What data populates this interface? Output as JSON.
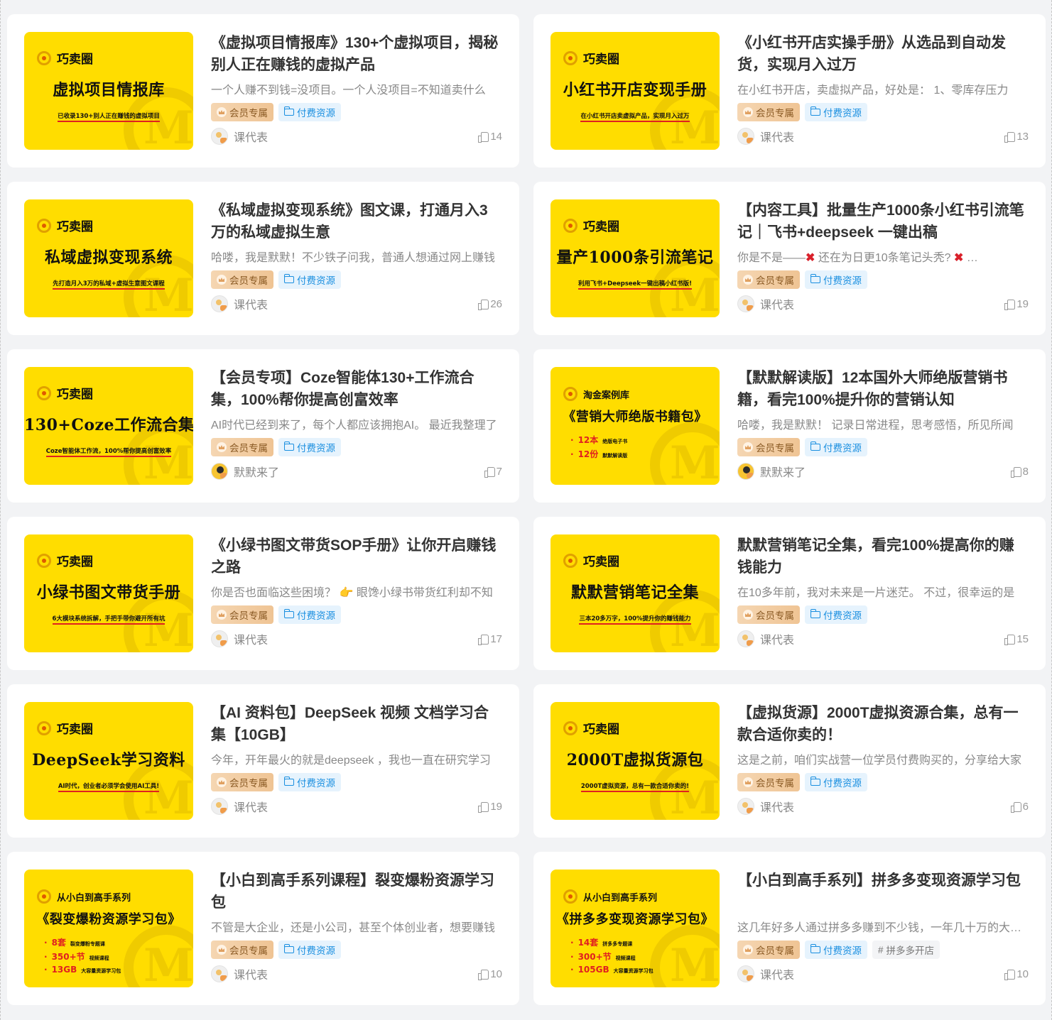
{
  "cards": [
    {
      "thumb": {
        "style": "brand",
        "brand": "巧卖圈",
        "title": "虚拟项目情报库",
        "subtitle": "已收录130+别人正在赚钱的虚拟项目"
      },
      "title": "《虚拟项目情报库》130+个虚拟项目，揭秘别人正在赚钱的虚拟产品",
      "excerpt": "一个人赚不到钱=没项目。一个人没项目=不知道卖什么",
      "tags": [
        "会员专属",
        "付费资源"
      ],
      "author": "课代表",
      "likes": "14"
    },
    {
      "thumb": {
        "style": "brand",
        "brand": "巧卖圈",
        "title": "小红书开店变现手册",
        "subtitle": "在小红书开店卖虚拟产品，实现月入过万"
      },
      "title": "《小红书开店实操手册》从选品到自动发货，实现月入过万",
      "excerpt": "在小红书开店，卖虚拟产品，好处是：  1、零库存压力",
      "tags": [
        "会员专属",
        "付费资源"
      ],
      "author": "课代表",
      "likes": "13"
    },
    {
      "thumb": {
        "style": "brand",
        "brand": "巧卖圈",
        "title": "私域虚拟变现系统",
        "subtitle": "先打造月入3万的私域+虚拟生意图文课程"
      },
      "title": "《私域虚拟变现系统》图文课，打通月入3万的私域虚拟生意",
      "excerpt": "哈喽，我是默默！不少铁子问我，普通人想通过网上赚钱",
      "tags": [
        "会员专属",
        "付费资源"
      ],
      "author": "课代表",
      "likes": "26"
    },
    {
      "thumb": {
        "style": "brand",
        "brand": "巧卖圈",
        "title": "量产1000条引流笔记",
        "subtitle": "利用飞书+Deepseek一键出稿小红书版!"
      },
      "title": "【内容工具】批量生产1000条小红书引流笔记｜飞书+deepseek 一键出稿",
      "excerpt_parts": [
        "你是不是——",
        "✖",
        " 还在为日更10条笔记头秃? ",
        "✖",
        " …"
      ],
      "tags": [
        "会员专属",
        "付费资源"
      ],
      "author": "课代表",
      "likes": "19"
    },
    {
      "thumb": {
        "style": "brand",
        "brand": "巧卖圈",
        "title": "130+Coze工作流合集",
        "subtitle": "Coze智能体工作流，100%帮你提高创富效率"
      },
      "title": "【会员专项】Coze智能体130+工作流合集，100%帮你提高创富效率",
      "excerpt": " AI时代已经到来了，每个人都应该拥抱AI。 最近我整理了",
      "tags": [
        "会员专属",
        "付费资源"
      ],
      "author": "默默来了",
      "avatar": "photo",
      "likes": "7"
    },
    {
      "thumb": {
        "style": "list",
        "brand": "淘金案例库",
        "title": "《营销大师绝版书籍包》",
        "items": [
          [
            "12本",
            "绝版电子书"
          ],
          [
            "12份",
            "默默解读版"
          ]
        ]
      },
      "title": "【默默解读版】12本国外大师绝版营销书籍，看完100%提升你的营销认知",
      "excerpt": "哈喽，我是默默！  记录日常进程，思考感悟，所见所闻",
      "tags": [
        "会员专属",
        "付费资源"
      ],
      "author": "默默来了",
      "avatar": "photo",
      "likes": "8"
    },
    {
      "thumb": {
        "style": "brand",
        "brand": "巧卖圈",
        "title": "小绿书图文带货手册",
        "subtitle": "6大模块系统拆解，手把手带你避开所有坑"
      },
      "title": "《小绿书图文带货SOP手册》让你开启赚钱之路",
      "excerpt_parts": [
        "你是否也面临这些困境？ ",
        "👉",
        " 眼馋小绿书带货红利却不知"
      ],
      "tags": [
        "会员专属",
        "付费资源"
      ],
      "author": "课代表",
      "likes": "17"
    },
    {
      "thumb": {
        "style": "brand",
        "brand": "巧卖圈",
        "title": "默默营销笔记全集",
        "subtitle": "三本20多万字，100%提升你的赚钱能力"
      },
      "title": "默默营销笔记全集，看完100%提高你的赚钱能力",
      "excerpt": "在10多年前，我对未来是一片迷茫。 不过，很幸运的是",
      "tags": [
        "会员专属",
        "付费资源"
      ],
      "author": "课代表",
      "likes": "15"
    },
    {
      "thumb": {
        "style": "brand",
        "brand": "巧卖圈",
        "title": "DeepSeek学习资料",
        "subtitle": "AI时代，创业者必须学会使用AI工具!"
      },
      "title": "【AI 资料包】DeepSeek 视频 文档学习合集【10GB】",
      "excerpt": "今年，开年最火的就是deepseek ，我也一直在研究学习",
      "tags": [
        "会员专属",
        "付费资源"
      ],
      "author": "课代表",
      "likes": "19"
    },
    {
      "thumb": {
        "style": "brand",
        "brand": "巧卖圈",
        "title": "2000T虚拟货源包",
        "subtitle": "2000T虚拟资源，总有一款合适你卖的!"
      },
      "title": "【虚拟货源】2000T虚拟资源合集，总有一款合适你卖的！",
      "excerpt": "这是之前，咱们实战营一位学员付费购买的，分享给大家",
      "tags": [
        "会员专属",
        "付费资源"
      ],
      "author": "课代表",
      "likes": "6"
    },
    {
      "thumb": {
        "style": "list",
        "brand": "从小白到高手系列",
        "title": "《裂变爆粉资源学习包》",
        "items": [
          [
            "8套",
            "裂变爆粉专题课"
          ],
          [
            "350+节",
            "视频课程"
          ],
          [
            "13GB",
            "大容量资源学习包"
          ]
        ]
      },
      "title": "【小白到高手系列课程】裂变爆粉资源学习包",
      "excerpt": "不管是大企业，还是小公司，甚至个体创业者，想要赚钱",
      "tags": [
        "会员专属",
        "付费资源"
      ],
      "author": "课代表",
      "likes": "10"
    },
    {
      "thumb": {
        "style": "list",
        "brand": "从小白到高手系列",
        "title": "《拼多多变现资源学习包》",
        "items": [
          [
            "14套",
            "拼多多专题课"
          ],
          [
            "300+节",
            "视频课程"
          ],
          [
            "105GB",
            "大容量资源学习包"
          ]
        ]
      },
      "title": "【小白到高手系列】拼多多变现资源学习包",
      "excerpt": "这几年好多人通过拼多多赚到不少钱，一年几十万的大有人在",
      "tags": [
        "会员专属",
        "付费资源",
        "拼多多开店"
      ],
      "author": "课代表",
      "likes": "10"
    }
  ],
  "colors": {
    "thumb_bg": "#ffdd00",
    "vip_tag": "#efc494",
    "paid_tag": "#1a8fe0"
  }
}
